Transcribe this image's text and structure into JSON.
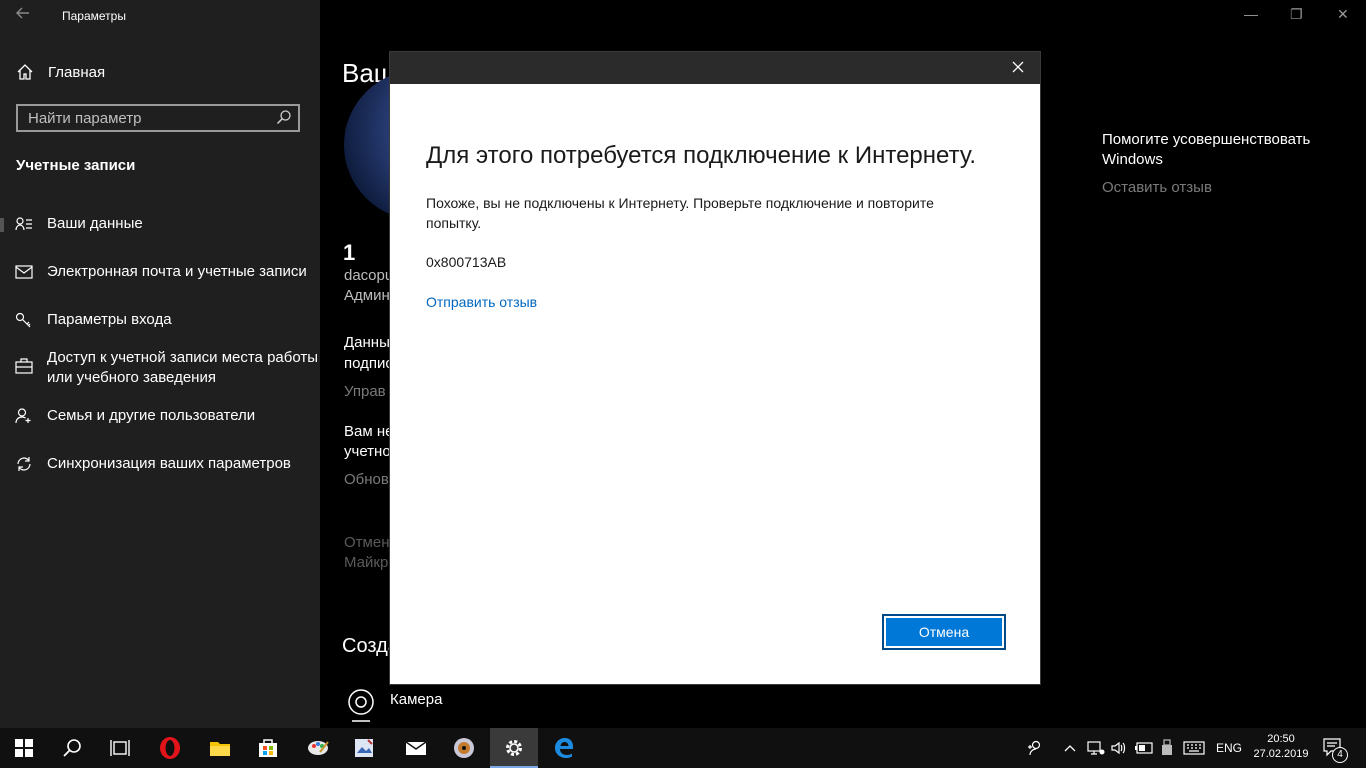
{
  "window": {
    "title": "Параметры",
    "back_icon": "arrow-left-icon",
    "minimize_glyph": "—",
    "restore_glyph": "❐",
    "close_glyph": "✕"
  },
  "sidebar": {
    "home_label": "Главная",
    "search_placeholder": "Найти параметр",
    "section_title": "Учетные записи",
    "items": [
      {
        "label": "Ваши данные",
        "icon": "person-list-icon"
      },
      {
        "label": "Электронная почта и учетные записи",
        "icon": "mail-icon"
      },
      {
        "label": "Параметры входа",
        "icon": "key-icon"
      },
      {
        "label": "Доступ к учетной записи места работы или учебного заведения",
        "icon": "briefcase-icon"
      },
      {
        "label": "Семья и другие пользователи",
        "icon": "person-add-icon"
      },
      {
        "label": "Синхронизация ваших параметров",
        "icon": "sync-icon"
      }
    ]
  },
  "main": {
    "page_title_partial": "Ваш",
    "user_name": "1",
    "user_email_partial": "dacopu",
    "user_role_partial": "Админ",
    "billing_line1": "Данны",
    "billing_line2": "подпис",
    "billing_link": "Управ",
    "verify_line1": "Вам не",
    "verify_line2": "учетно",
    "verify_link": "Обнов",
    "stop_line1": "Отмен",
    "stop_line2": "Майкр",
    "create_title": "Созда",
    "camera_label": "Камера"
  },
  "help": {
    "title": "Помогите усовершенствовать Windows",
    "feedback_link": "Оставить отзыв"
  },
  "dialog": {
    "heading": "Для этого потребуется подключение к Интернету.",
    "body": "Похоже, вы не подключены к Интернету. Проверьте подключение и повторите попытку.",
    "error_code": "0x800713AB",
    "feedback_link": "Отправить отзыв",
    "cancel_label": "Отмена"
  },
  "taskbar": {
    "apps": [
      "start-icon",
      "search-icon",
      "task-view-icon",
      "opera-icon",
      "file-explorer-icon",
      "store-icon",
      "paint-icon",
      "image-editor-icon",
      "mail-icon",
      "media-icon",
      "settings-icon",
      "edge-icon"
    ],
    "active_app": "settings-icon",
    "language": "ENG",
    "time": "20:50",
    "date": "27.02.2019",
    "notification_count": "4"
  }
}
